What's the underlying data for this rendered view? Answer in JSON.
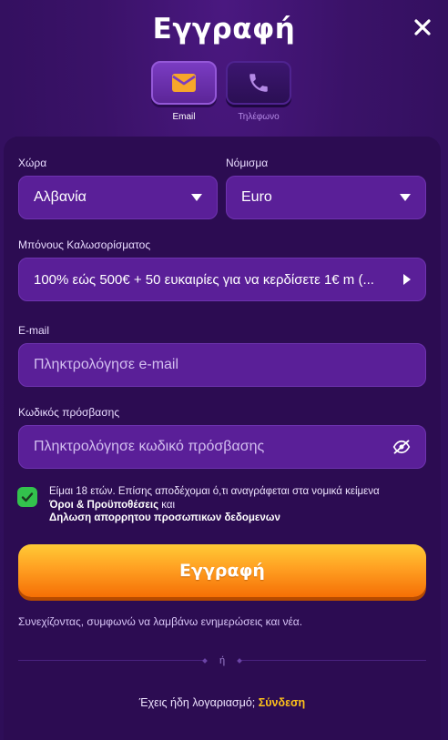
{
  "header": {
    "title": "Εγγραφή",
    "close_icon": "close-icon"
  },
  "tabs": [
    {
      "label": "Email",
      "icon": "envelope-icon",
      "active": true,
      "icon_color": "#f7a62a"
    },
    {
      "label": "Τηλέφωνο",
      "icon": "phone-icon",
      "active": false,
      "icon_color": "#b48ae6"
    }
  ],
  "form": {
    "country": {
      "label": "Χώρα",
      "value": "Αλβανία"
    },
    "currency": {
      "label": "Νόμισμα",
      "value": "Euro"
    },
    "bonus": {
      "label": "Μπόνους Καλωσορίσματος",
      "value": "100% εώς 500€ + 50 ευκαιρίες για να κερδίσετε 1€ m (..."
    },
    "email": {
      "label": "E-mail",
      "placeholder": "Πληκτρολόγησε e-mail"
    },
    "password": {
      "label": "Κωδικός πρόσβασης",
      "placeholder": "Πληκτρολόγησε κωδικό πρόσβασης",
      "icon": "eye-off-icon"
    },
    "consent": {
      "checked": true,
      "text": "Είμαι 18 ετών. Επίσης αποδέχομαι ό,τι αναγράφεται στα νομικά κείμενα",
      "terms_link": "Όροι & Προϋποθέσεις",
      "and": "και",
      "privacy_link": "Δηλωση απορρητου προσωπικων δεδομενων"
    },
    "submit_label": "Εγγραφή",
    "notice": "Συνεχίζοντας, συμφωνώ να λαμβάνω ενημερώσεις και νέα.",
    "divider_text": "ή",
    "login_prompt": "Έχεις ήδη λογαριασμό;",
    "login_link": "Σύνδεση"
  },
  "colors": {
    "background": "#3a1268",
    "card": "#2c0c52",
    "field": "#5a1f98",
    "accent_orange": "#ff9a1f",
    "link_yellow": "#ffc21a",
    "check_green": "#33c24d"
  }
}
